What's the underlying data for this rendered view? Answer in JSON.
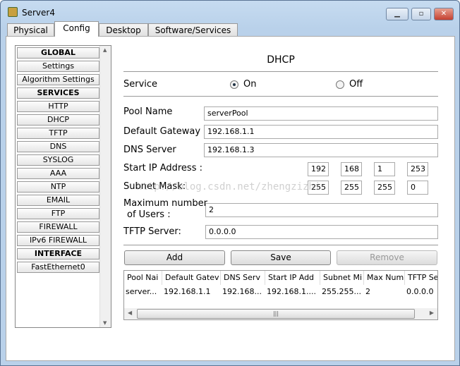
{
  "window": {
    "title": "Server4"
  },
  "tabs": [
    "Physical",
    "Config",
    "Desktop",
    "Software/Services"
  ],
  "sidebar": [
    "GLOBAL",
    "Settings",
    "Algorithm Settings",
    "SERVICES",
    "HTTP",
    "DHCP",
    "TFTP",
    "DNS",
    "SYSLOG",
    "AAA",
    "NTP",
    "EMAIL",
    "FTP",
    "FIREWALL",
    "IPv6 FIREWALL",
    "INTERFACE",
    "FastEthernet0"
  ],
  "dhcp": {
    "title": "DHCP",
    "service_label": "Service",
    "on_label": "On",
    "off_label": "Off",
    "pool_name_label": "Pool Name",
    "pool_name": "serverPool",
    "gateway_label": "Default Gateway",
    "gateway": "192.168.1.1",
    "dns_label": "DNS Server",
    "dns": "192.168.1.3",
    "start_ip_label": "Start IP Address :",
    "start_ip": [
      "192",
      "168",
      "1",
      "253"
    ],
    "subnet_label": "Subnet Mask:",
    "subnet": [
      "255",
      "255",
      "255",
      "0"
    ],
    "max_users_label1": "Maximum number",
    "max_users_label2": "of Users :",
    "max_users": "2",
    "tftp_label": "TFTP Server:",
    "tftp": "0.0.0.0",
    "add": "Add",
    "save": "Save",
    "remove": "Remove"
  },
  "table": {
    "headers": [
      "Pool Nai",
      "Default Gatev",
      "DNS Serv",
      "Start IP Add",
      "Subnet Mi",
      "Max Num",
      "TFTP Se"
    ],
    "rows": [
      [
        "server...",
        "192.168.1.1",
        "192.168...",
        "192.168.1....",
        "255.255...",
        "2",
        "0.0.0.0"
      ]
    ]
  },
  "watermark": "http://blog.csdn.net/zhengzizhi"
}
